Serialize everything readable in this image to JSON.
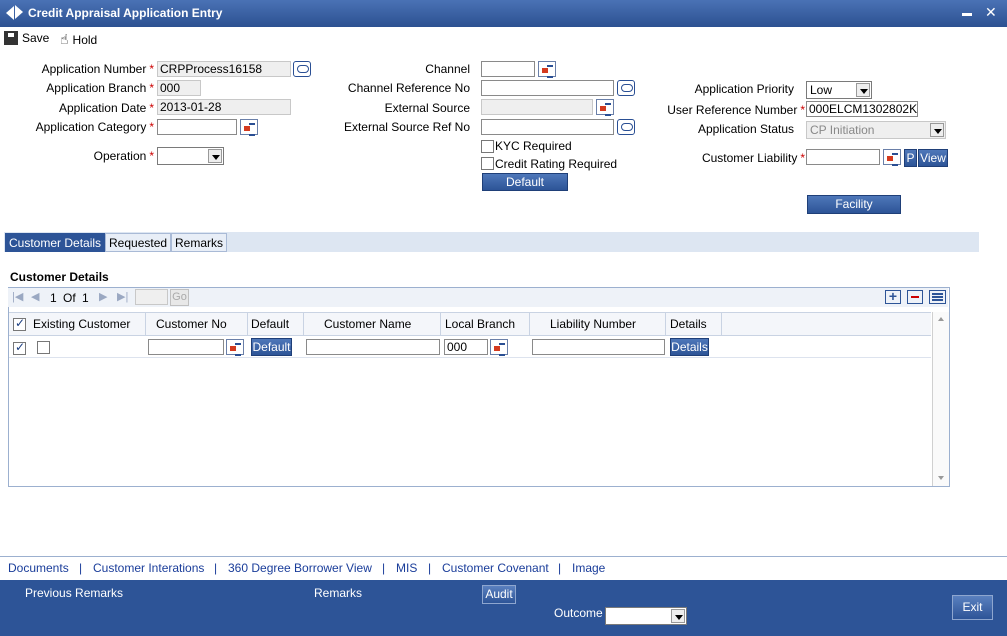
{
  "window": {
    "title": "Credit Appraisal Application Entry",
    "minimize": "▬",
    "close": "✕"
  },
  "toolbar": {
    "save": "Save",
    "hold": "Hold"
  },
  "form": {
    "application_number": {
      "label": "Application Number",
      "value": "CRPProcess16158"
    },
    "application_branch": {
      "label": "Application Branch",
      "value": "000"
    },
    "application_date": {
      "label": "Application Date",
      "value": "2013-01-28"
    },
    "application_category": {
      "label": "Application Category",
      "value": ""
    },
    "operation": {
      "label": "Operation",
      "value": ""
    },
    "channel": {
      "label": "Channel",
      "value": ""
    },
    "channel_reference_no": {
      "label": "Channel Reference No",
      "value": ""
    },
    "external_source": {
      "label": "External Source",
      "value": ""
    },
    "external_source_ref_no": {
      "label": "External Source Ref No",
      "value": ""
    },
    "kyc_required": {
      "label": "KYC Required",
      "checked": false
    },
    "credit_rating_required": {
      "label": "Credit Rating Required",
      "checked": false
    },
    "default_liability_button": "Default Liability",
    "application_priority": {
      "label": "Application Priority",
      "value": "Low"
    },
    "user_reference_number": {
      "label": "User Reference Number",
      "value": "000ELCM1302802KH"
    },
    "application_status": {
      "label": "Application Status",
      "value": "CP Initiation"
    },
    "customer_liability": {
      "label": "Customer Liability",
      "value": "",
      "p_button": "P",
      "view_button": "View"
    },
    "facility_hierarchy_button": "Facility Hierarchy",
    "required_marker": "*"
  },
  "tabs": [
    "Customer Details",
    "Requested",
    "Remarks"
  ],
  "customer_details": {
    "section_title": "Customer Details",
    "pager": {
      "page": "1",
      "of_label": "Of",
      "total": "1",
      "go": "Go"
    },
    "columns": [
      "Existing Customer",
      "Customer No",
      "Default",
      "Customer Name",
      "Local Branch",
      "Liability Number",
      "Details"
    ],
    "row": {
      "customer_no": "",
      "default_button": "Default",
      "customer_name": "",
      "local_branch": "000",
      "liability_number": "",
      "details_button": "Details"
    }
  },
  "links": [
    "Documents",
    "Customer Interations",
    "360 Degree Borrower View",
    "MIS",
    "Customer Covenant",
    "Image"
  ],
  "link_separator": "|",
  "footer": {
    "previous_remarks": "Previous Remarks",
    "remarks": "Remarks",
    "audit": "Audit",
    "outcome": "Outcome",
    "outcome_value": "",
    "exit": "Exit"
  },
  "colors": {
    "header_blue": "#2d5497",
    "required_red": "#cc0000",
    "link_blue": "#1a3d9a"
  }
}
